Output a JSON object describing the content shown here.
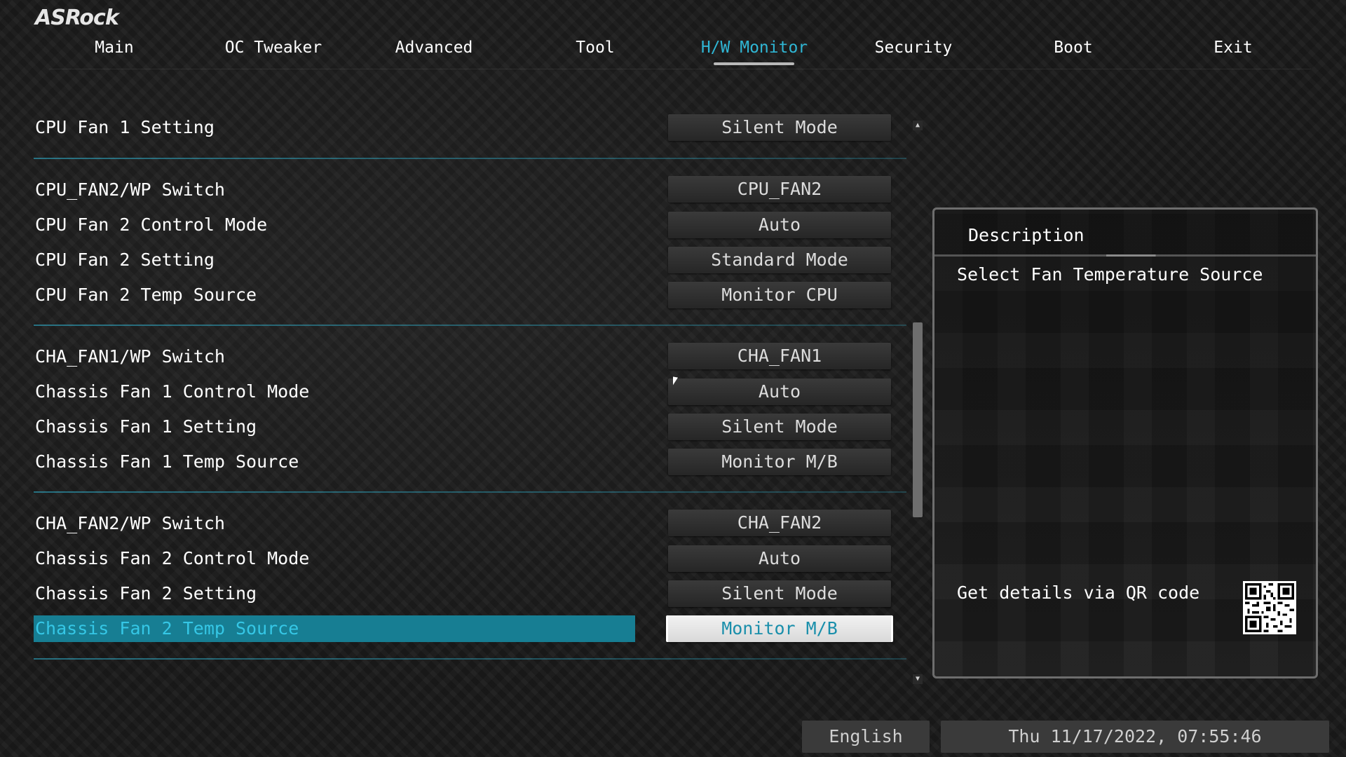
{
  "app": {
    "logo": "ASRock"
  },
  "tabs": [
    {
      "label": "Main"
    },
    {
      "label": "OC Tweaker"
    },
    {
      "label": "Advanced"
    },
    {
      "label": "Tool"
    },
    {
      "label": "H/W Monitor",
      "active": true
    },
    {
      "label": "Security"
    },
    {
      "label": "Boot"
    },
    {
      "label": "Exit"
    }
  ],
  "settings": [
    {
      "label": "CPU Fan 1 Setting",
      "value": "Silent Mode"
    },
    {
      "label": "CPU_FAN2/WP Switch",
      "value": "CPU_FAN2"
    },
    {
      "label": "CPU Fan 2 Control Mode",
      "value": "Auto"
    },
    {
      "label": "CPU Fan 2 Setting",
      "value": "Standard Mode"
    },
    {
      "label": "CPU Fan 2 Temp Source",
      "value": "Monitor CPU"
    },
    {
      "label": "CHA_FAN1/WP Switch",
      "value": "CHA_FAN1"
    },
    {
      "label": "Chassis Fan 1 Control Mode",
      "value": "Auto"
    },
    {
      "label": "Chassis Fan 1 Setting",
      "value": "Silent Mode"
    },
    {
      "label": "Chassis Fan 1 Temp Source",
      "value": "Monitor M/B"
    },
    {
      "label": "CHA_FAN2/WP Switch",
      "value": "CHA_FAN2"
    },
    {
      "label": "Chassis Fan 2 Control Mode",
      "value": "Auto"
    },
    {
      "label": "Chassis Fan 2 Setting",
      "value": "Silent Mode"
    },
    {
      "label": "Chassis Fan 2 Temp Source",
      "value": "Monitor M/B",
      "selected": true
    }
  ],
  "description": {
    "title": "Description",
    "text": "Select Fan Temperature Source",
    "qr_label": "Get details via QR code"
  },
  "status_bar": {
    "language": "English",
    "datetime": "Thu 11/17/2022, 07:55:46"
  },
  "colors": {
    "accent": "#2fb6d4",
    "selected_row": "#177e93"
  }
}
